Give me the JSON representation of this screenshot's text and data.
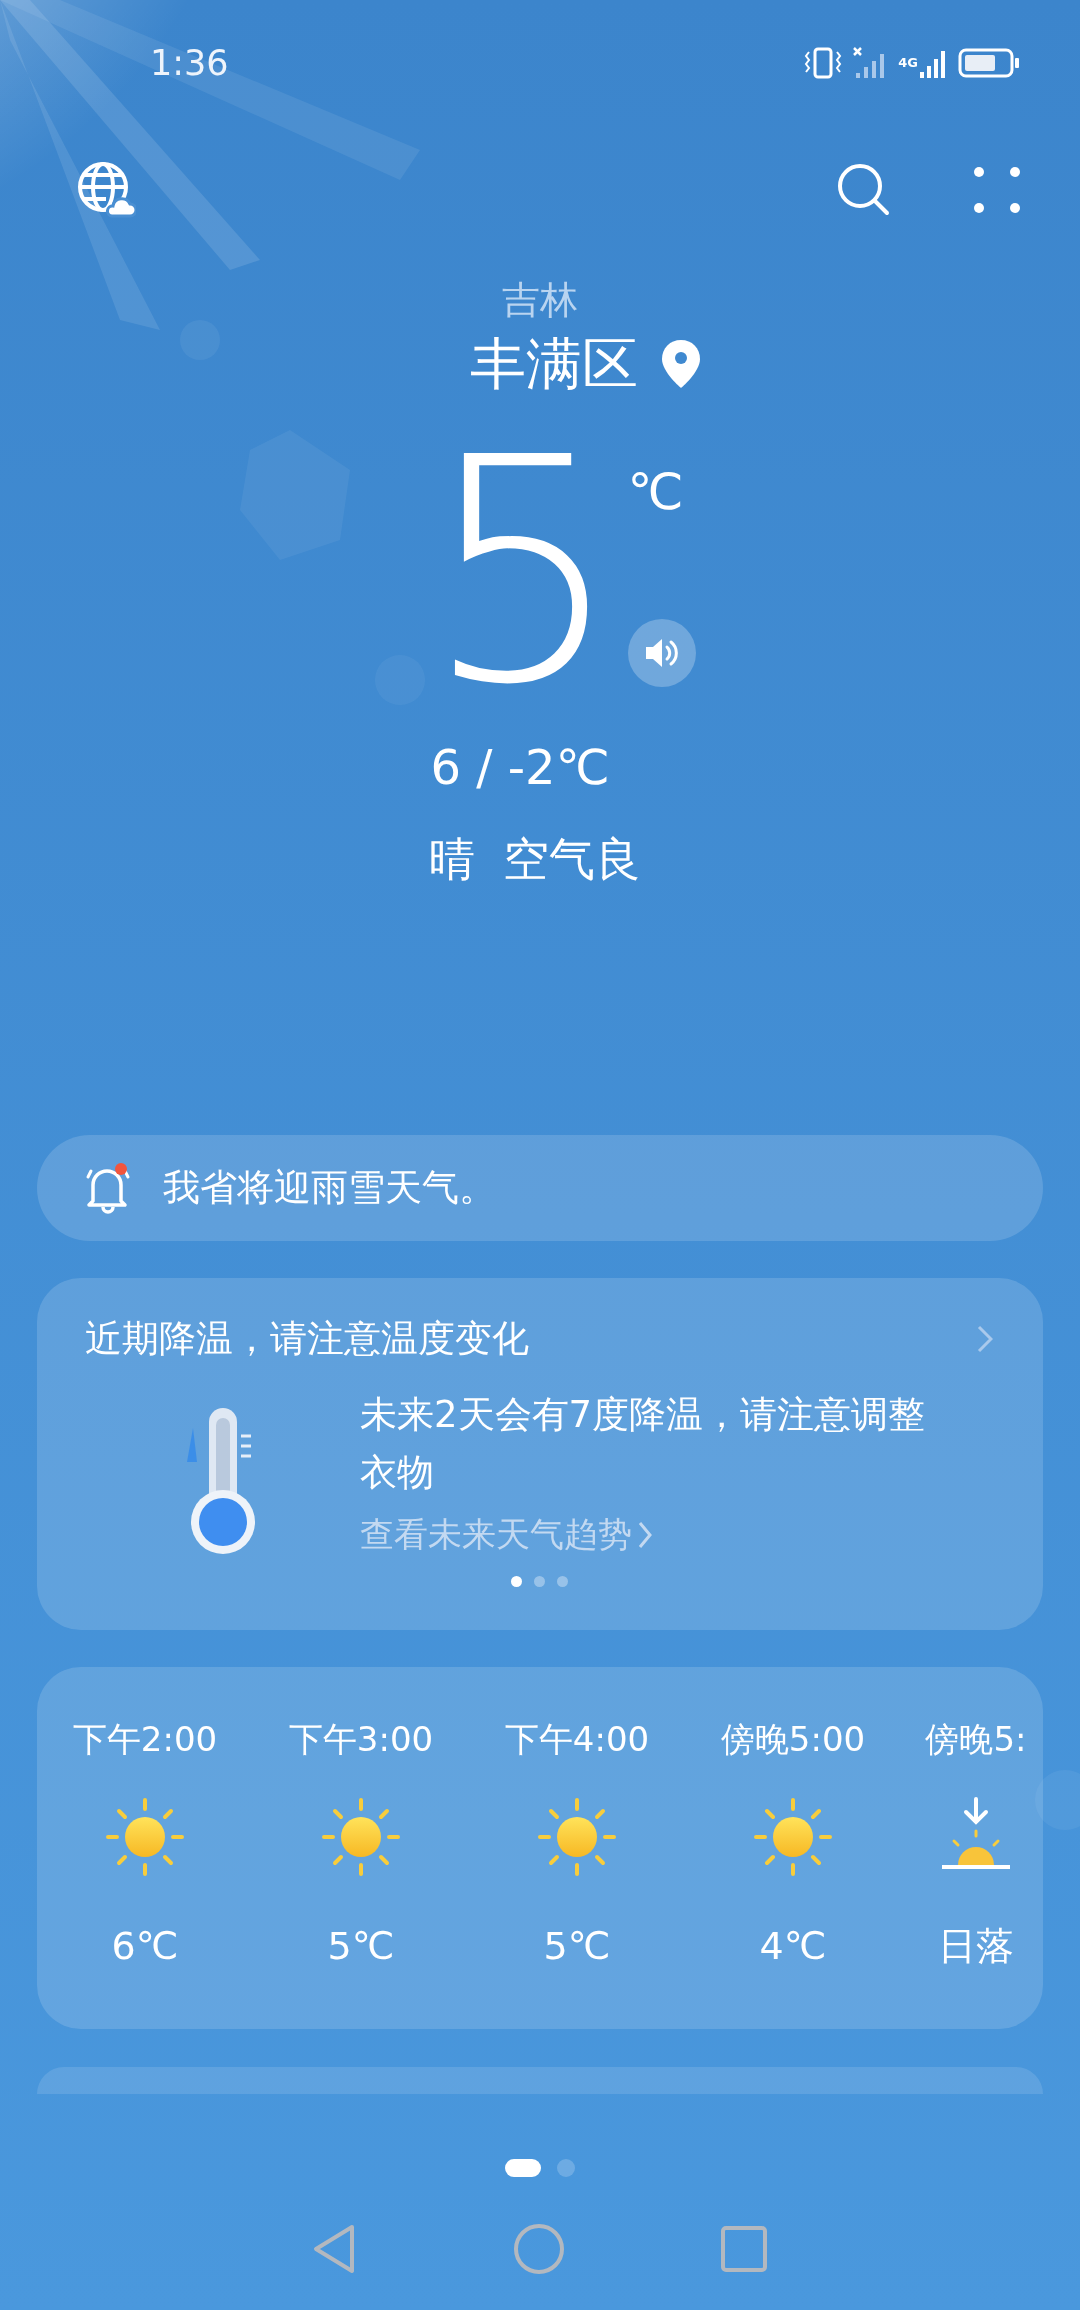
{
  "status_bar": {
    "time": "1:36",
    "network": "4G"
  },
  "header": {
    "region": "吉林",
    "district": "丰满区"
  },
  "current": {
    "temperature": "5",
    "unit": "℃",
    "high_low": "6 / -2℃",
    "condition": "晴",
    "air_quality": "空气良"
  },
  "alert": {
    "text": "我省将迎雨雪天气。",
    "unread": true
  },
  "tip_card": {
    "title": "近期降温，请注意温度变化",
    "message": "未来2天会有7度降温，请注意调整衣物",
    "link": "查看未来天气趋势",
    "pages": [
      {
        "selected": true
      },
      {
        "selected": false
      },
      {
        "selected": false
      }
    ]
  },
  "hourly": [
    {
      "kind": "weather",
      "time": "下午2:00",
      "value": "6℃"
    },
    {
      "kind": "weather",
      "time": "下午3:00",
      "value": "5℃"
    },
    {
      "kind": "weather",
      "time": "下午4:00",
      "value": "5℃"
    },
    {
      "kind": "weather",
      "time": "傍晚5:00",
      "value": "4℃"
    },
    {
      "kind": "sunset",
      "time": "傍晚5:",
      "value": "日落"
    }
  ],
  "pages": [
    {
      "selected": true
    },
    {
      "selected": false
    }
  ]
}
